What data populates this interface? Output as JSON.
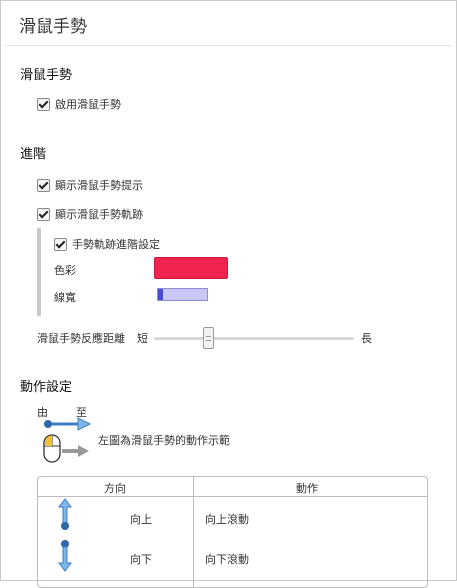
{
  "header": {
    "title": "滑鼠手勢"
  },
  "sections": {
    "gesture": {
      "title": "滑鼠手勢",
      "enable_label": "啟用滑鼠手勢"
    },
    "advanced": {
      "title": "進階",
      "show_hint_label": "顯示滑鼠手勢提示",
      "show_trail_label": "顯示滑鼠手勢軌跡",
      "trail_advanced_label": "手勢軌跡進階設定",
      "color_label": "色彩",
      "color_value": "#f0244f",
      "width_label": "線寬",
      "width_fraction": 0.1,
      "sensitivity_label": "滑鼠手勢反應距離",
      "short_label": "短",
      "long_label": "長",
      "sensitivity_fraction": 0.27
    },
    "actions": {
      "title": "動作設定",
      "from_label": "由",
      "to_label": "至",
      "demo_text": "左圖為滑鼠手勢的動作示範",
      "table": {
        "headers": [
          "方向",
          "動作"
        ],
        "rows": [
          {
            "direction": "向上",
            "action": "向上滾動",
            "icon": "arrow-up-icon"
          },
          {
            "direction": "向下",
            "action": "向下滾動",
            "icon": "arrow-down-icon"
          }
        ]
      }
    }
  },
  "colors": {
    "arrow_blue": "#3b7fc4",
    "gray_arrow": "#9a9a9a",
    "swatch": "#f0244f"
  }
}
